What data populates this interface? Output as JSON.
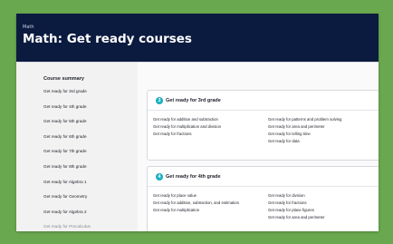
{
  "header": {
    "eyebrow": "Math",
    "title": "Math: Get ready courses"
  },
  "sidebar": {
    "heading": "Course summary",
    "items": [
      "Get ready for 3rd grade",
      "Get ready for 4th grade",
      "Get ready for 5th grade",
      "Get ready for 6th grade",
      "Get ready for 7th grade",
      "Get ready for 8th grade",
      "Get ready for Algebra 1",
      "Get ready for Geometry",
      "Get ready for Algebra 2",
      "Get ready for Precalculus"
    ]
  },
  "cards": [
    {
      "badge": "3",
      "title": "Get ready for 3rd grade",
      "left": [
        "Get ready for addition and subtraction",
        "Get ready for multiplication and division",
        "Get ready for fractions"
      ],
      "right": [
        "Get ready for patterns and problem solving",
        "Get ready for area and perimeter",
        "Get ready for telling time",
        "Get ready for data"
      ]
    },
    {
      "badge": "4",
      "title": "Get ready for 4th grade",
      "left": [
        "Get ready for place value",
        "Get ready for addition, subtraction, and estimation",
        "Get ready for multiplication"
      ],
      "right": [
        "Get ready for division",
        "Get ready for fractions",
        "Get ready for plane figures",
        "Get ready for area and perimeter"
      ]
    }
  ],
  "colors": {
    "background": "#6aa84f",
    "header": "#0b1b3f",
    "badge": "#1cb8c9"
  }
}
